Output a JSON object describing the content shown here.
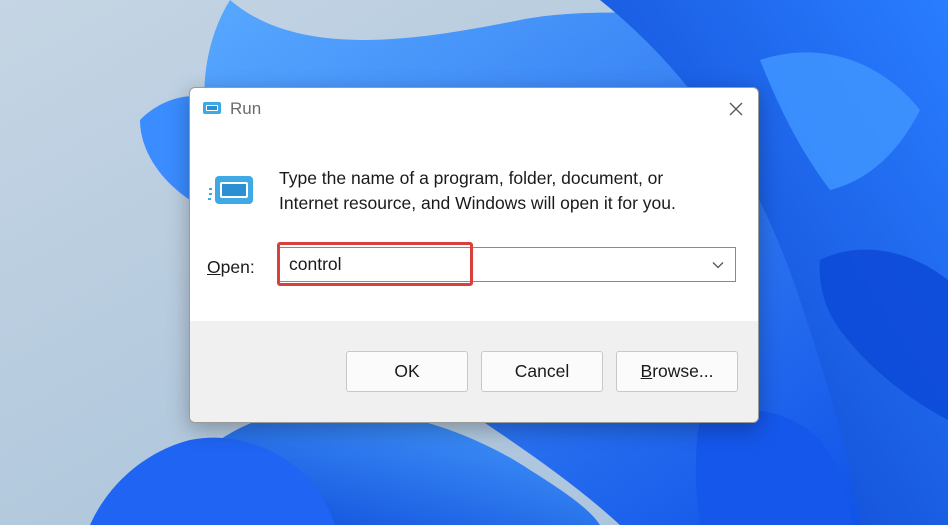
{
  "dialog": {
    "title": "Run",
    "description": "Type the name of a program, folder, document, or Internet resource, and Windows will open it for you.",
    "open_label_accel": "O",
    "open_label_rest": "pen:",
    "input_value": "control"
  },
  "buttons": {
    "ok": "OK",
    "cancel": "Cancel",
    "browse_accel": "B",
    "browse_rest": "rowse..."
  },
  "icons": {
    "title": "run-icon",
    "body": "run-icon",
    "close": "close-icon",
    "dropdown": "chevron-down-icon"
  },
  "colors": {
    "highlight": "#d9403b",
    "wallpaper_blue": "#1f6bff",
    "footer": "#f0f0f0"
  }
}
